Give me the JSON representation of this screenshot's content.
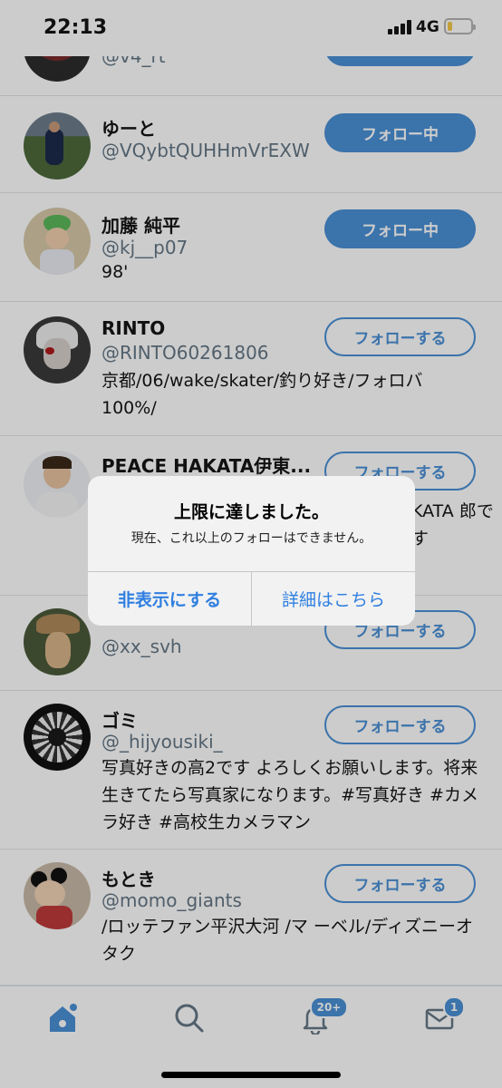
{
  "status": {
    "time": "22:13",
    "network": "4G"
  },
  "buttons": {
    "following": "フォロー中",
    "follow": "フォローする"
  },
  "users": [
    {
      "name": "",
      "handle": "@v4_rt",
      "bio": "",
      "state": "following"
    },
    {
      "name": "ゆーと",
      "handle": "@VQybtQUHHmVrEXW",
      "bio": "",
      "state": "following"
    },
    {
      "name": "加藤 純平",
      "handle": "@kj__p07",
      "bio": "98'",
      "state": "following"
    },
    {
      "name": "RINTO",
      "handle": "@RINTO60261806",
      "bio": "京都/06/wake/skater/釣り好き/フォロバ100%/",
      "state": "follow"
    },
    {
      "name": "PEACE HAKATA伊東...",
      "handle": "",
      "bio": "KATA 郎です",
      "state": "follow"
    },
    {
      "name": "",
      "handle": "@xx_svh",
      "bio": "",
      "state": "follow"
    },
    {
      "name": "ゴミ",
      "handle": "@_hijyousiki_",
      "bio": "写真好きの高2です よろしくお願いします。将来生きてたら写真家になります。#写真好き #カメラ好き #高校生カメラマン",
      "state": "follow"
    },
    {
      "name": "もとき",
      "handle": "@momo_giants",
      "bio": "/ロッテファン平沢大河 /マ ーベル/ディズニーオタク",
      "state": "follow"
    }
  ],
  "alert": {
    "title": "上限に達しました。",
    "message": "現在、これ以上のフォローはできません。",
    "hide_label": "非表示にする",
    "details_label": "詳細はこちら"
  },
  "tabbar": {
    "notifications_badge": "20+",
    "messages_badge": "1",
    "accent_color": "#4a90d6"
  }
}
